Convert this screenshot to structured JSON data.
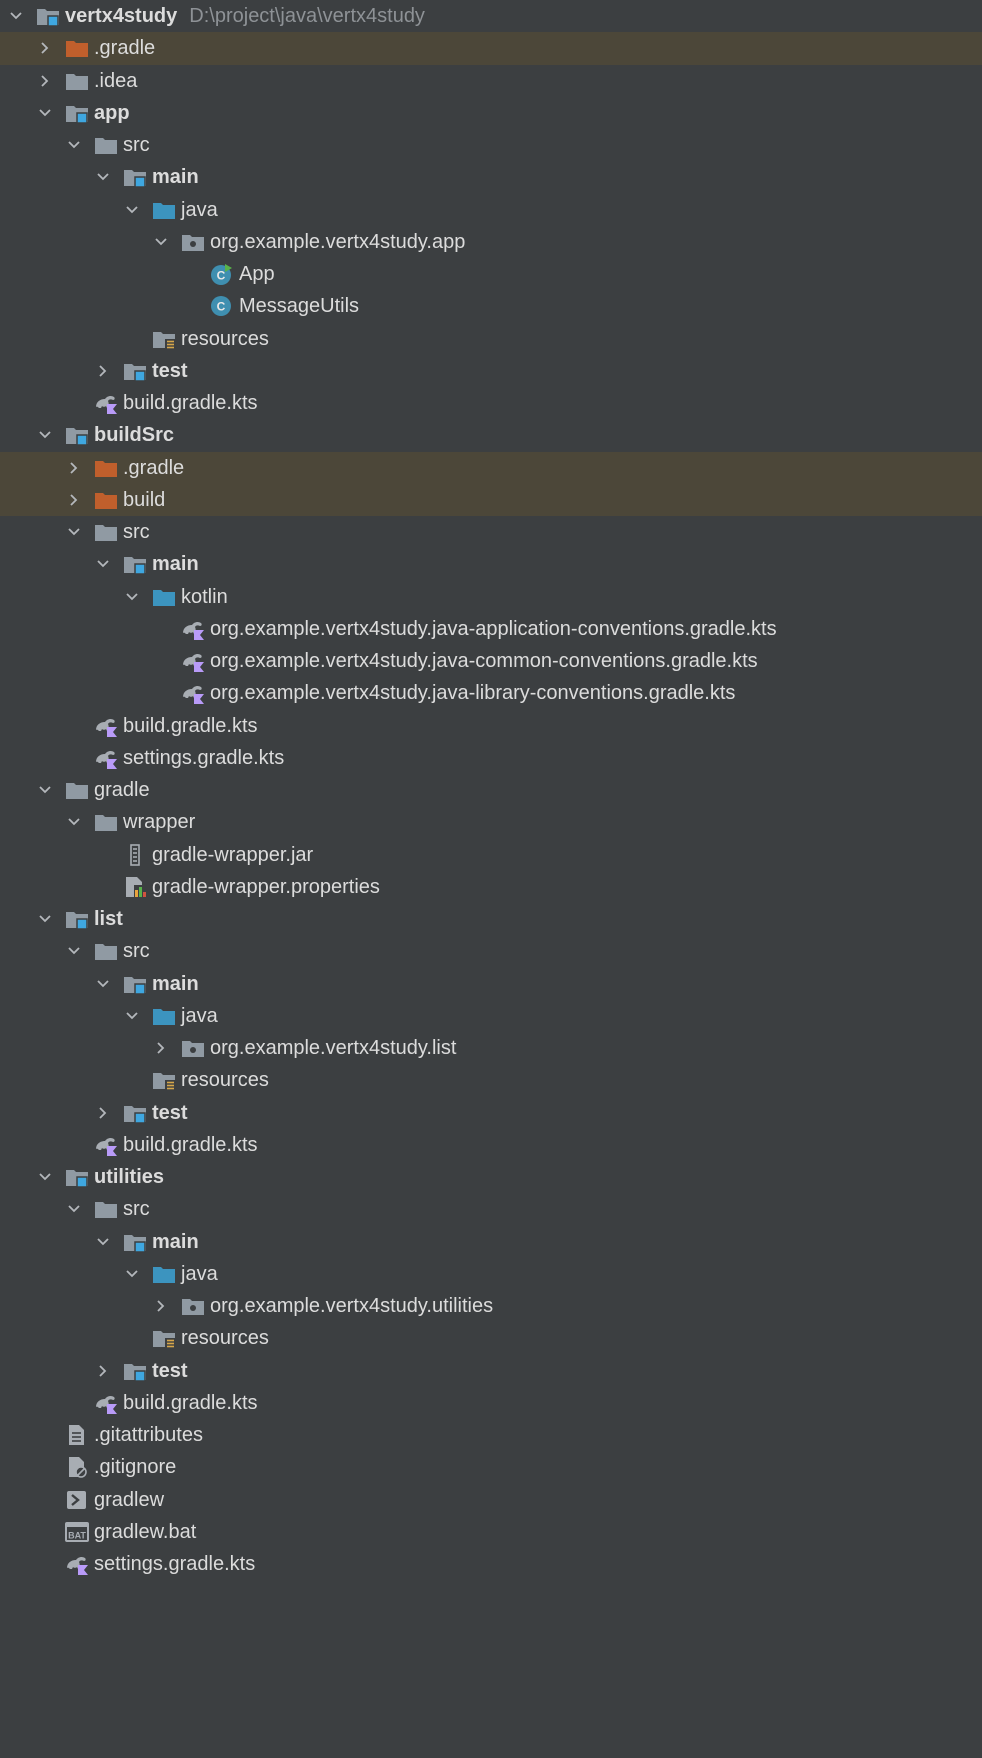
{
  "project_tree": {
    "rows": [
      {
        "label": "vertx4study",
        "extra": "D:\\project\\java\\vertx4study",
        "depth": 0,
        "chevron": "down",
        "icon": "module-folder-icon",
        "bold": true
      },
      {
        "label": ".gradle",
        "depth": 1,
        "chevron": "right",
        "icon": "excluded-folder-icon",
        "excluded": true
      },
      {
        "label": ".idea",
        "depth": 1,
        "chevron": "right",
        "icon": "folder-icon"
      },
      {
        "label": "app",
        "depth": 1,
        "chevron": "down",
        "icon": "module-folder-icon",
        "bold": true
      },
      {
        "label": "src",
        "depth": 2,
        "chevron": "down",
        "icon": "folder-icon"
      },
      {
        "label": "main",
        "depth": 3,
        "chevron": "down",
        "icon": "module-folder-icon",
        "bold": true
      },
      {
        "label": "java",
        "depth": 4,
        "chevron": "down",
        "icon": "source-folder-icon"
      },
      {
        "label": "org.example.vertx4study.app",
        "depth": 5,
        "chevron": "down",
        "icon": "package-icon"
      },
      {
        "label": "App",
        "depth": 6,
        "chevron": "none",
        "icon": "java-main-class-icon"
      },
      {
        "label": "MessageUtils",
        "depth": 6,
        "chevron": "none",
        "icon": "java-class-icon"
      },
      {
        "label": "resources",
        "depth": 4,
        "chevron": "none",
        "icon": "resources-folder-icon"
      },
      {
        "label": "test",
        "depth": 3,
        "chevron": "right",
        "icon": "module-folder-icon",
        "bold": true
      },
      {
        "label": "build.gradle.kts",
        "depth": 2,
        "chevron": "none",
        "icon": "gradle-kts-icon"
      },
      {
        "label": "buildSrc",
        "depth": 1,
        "chevron": "down",
        "icon": "module-folder-icon",
        "bold": true
      },
      {
        "label": ".gradle",
        "depth": 2,
        "chevron": "right",
        "icon": "excluded-folder-icon",
        "excluded": true
      },
      {
        "label": "build",
        "depth": 2,
        "chevron": "right",
        "icon": "excluded-folder-icon",
        "excluded": true
      },
      {
        "label": "src",
        "depth": 2,
        "chevron": "down",
        "icon": "folder-icon"
      },
      {
        "label": "main",
        "depth": 3,
        "chevron": "down",
        "icon": "module-folder-icon",
        "bold": true
      },
      {
        "label": "kotlin",
        "depth": 4,
        "chevron": "down",
        "icon": "source-folder-icon"
      },
      {
        "label": "org.example.vertx4study.java-application-conventions.gradle.kts",
        "depth": 5,
        "chevron": "none",
        "icon": "gradle-kts-icon"
      },
      {
        "label": "org.example.vertx4study.java-common-conventions.gradle.kts",
        "depth": 5,
        "chevron": "none",
        "icon": "gradle-kts-icon"
      },
      {
        "label": "org.example.vertx4study.java-library-conventions.gradle.kts",
        "depth": 5,
        "chevron": "none",
        "icon": "gradle-kts-icon"
      },
      {
        "label": "build.gradle.kts",
        "depth": 2,
        "chevron": "none",
        "icon": "gradle-kts-icon"
      },
      {
        "label": "settings.gradle.kts",
        "depth": 2,
        "chevron": "none",
        "icon": "gradle-kts-icon"
      },
      {
        "label": "gradle",
        "depth": 1,
        "chevron": "down",
        "icon": "folder-icon"
      },
      {
        "label": "wrapper",
        "depth": 2,
        "chevron": "down",
        "icon": "folder-icon"
      },
      {
        "label": "gradle-wrapper.jar",
        "depth": 3,
        "chevron": "none",
        "icon": "jar-file-icon"
      },
      {
        "label": "gradle-wrapper.properties",
        "depth": 3,
        "chevron": "none",
        "icon": "properties-file-icon"
      },
      {
        "label": "list",
        "depth": 1,
        "chevron": "down",
        "icon": "module-folder-icon",
        "bold": true
      },
      {
        "label": "src",
        "depth": 2,
        "chevron": "down",
        "icon": "folder-icon"
      },
      {
        "label": "main",
        "depth": 3,
        "chevron": "down",
        "icon": "module-folder-icon",
        "bold": true
      },
      {
        "label": "java",
        "depth": 4,
        "chevron": "down",
        "icon": "source-folder-icon"
      },
      {
        "label": "org.example.vertx4study.list",
        "depth": 5,
        "chevron": "right",
        "icon": "package-icon"
      },
      {
        "label": "resources",
        "depth": 4,
        "chevron": "none",
        "icon": "resources-folder-icon"
      },
      {
        "label": "test",
        "depth": 3,
        "chevron": "right",
        "icon": "module-folder-icon",
        "bold": true
      },
      {
        "label": "build.gradle.kts",
        "depth": 2,
        "chevron": "none",
        "icon": "gradle-kts-icon"
      },
      {
        "label": "utilities",
        "depth": 1,
        "chevron": "down",
        "icon": "module-folder-icon",
        "bold": true
      },
      {
        "label": "src",
        "depth": 2,
        "chevron": "down",
        "icon": "folder-icon"
      },
      {
        "label": "main",
        "depth": 3,
        "chevron": "down",
        "icon": "module-folder-icon",
        "bold": true
      },
      {
        "label": "java",
        "depth": 4,
        "chevron": "down",
        "icon": "source-folder-icon"
      },
      {
        "label": "org.example.vertx4study.utilities",
        "depth": 5,
        "chevron": "right",
        "icon": "package-icon"
      },
      {
        "label": "resources",
        "depth": 4,
        "chevron": "none",
        "icon": "resources-folder-icon"
      },
      {
        "label": "test",
        "depth": 3,
        "chevron": "right",
        "icon": "module-folder-icon",
        "bold": true
      },
      {
        "label": "build.gradle.kts",
        "depth": 2,
        "chevron": "none",
        "icon": "gradle-kts-icon"
      },
      {
        "label": ".gitattributes",
        "depth": 1,
        "chevron": "none",
        "icon": "text-file-icon"
      },
      {
        "label": ".gitignore",
        "depth": 1,
        "chevron": "none",
        "icon": "gitignore-file-icon"
      },
      {
        "label": "gradlew",
        "depth": 1,
        "chevron": "none",
        "icon": "shell-script-icon"
      },
      {
        "label": "gradlew.bat",
        "depth": 1,
        "chevron": "none",
        "icon": "bat-file-icon"
      },
      {
        "label": "settings.gradle.kts",
        "depth": 1,
        "chevron": "none",
        "icon": "gradle-kts-icon"
      }
    ]
  },
  "colors": {
    "background": "#3c3f41",
    "excluded_row": "#4c4739",
    "text": "#dcdcdc",
    "secondary_text": "#8e9296",
    "folder": "#909aa3",
    "module_marker": "#3fa7e0",
    "source_folder": "#3c94bf",
    "excluded_folder": "#c05f2c",
    "class_icon": "#3f8fb0",
    "run_marker": "#59b34a",
    "kotlin_flag": "#b99bf8"
  }
}
